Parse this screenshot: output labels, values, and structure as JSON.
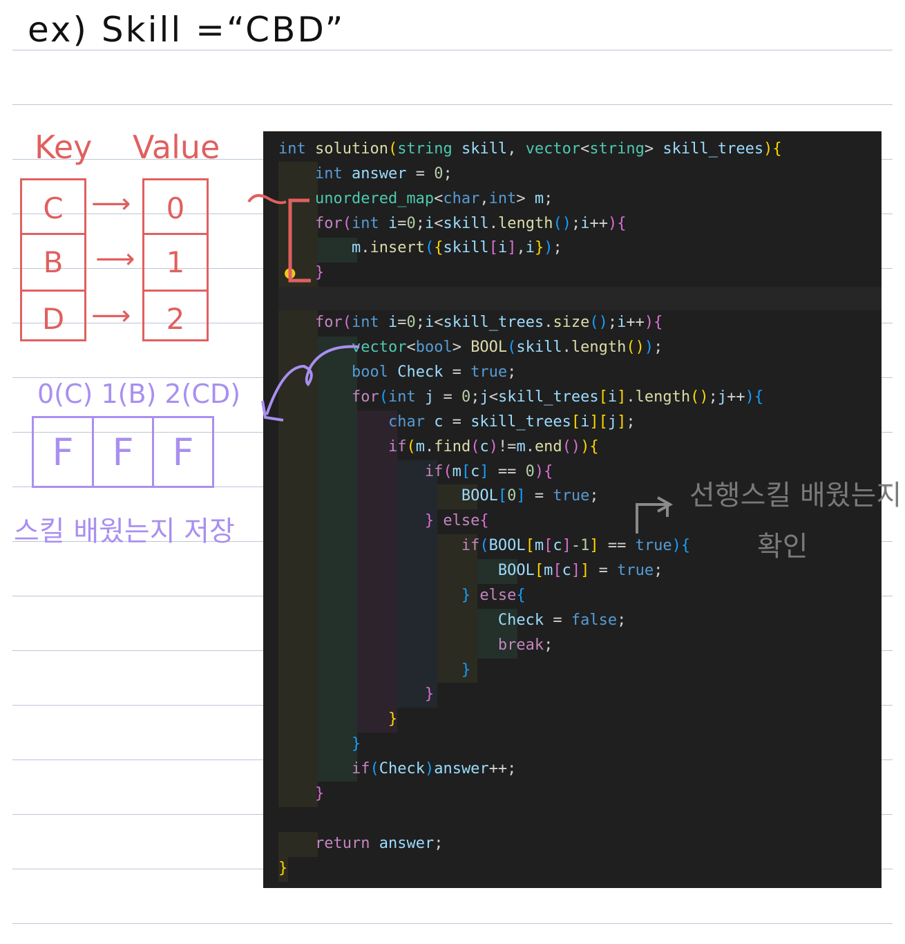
{
  "note": {
    "title": "ex) Skill =“CBD”",
    "map_key_label": "Key",
    "map_value_label": "Value",
    "map_rows": [
      {
        "key": "C",
        "value": "0"
      },
      {
        "key": "B",
        "value": "1"
      },
      {
        "key": "D",
        "value": "2"
      }
    ],
    "vector_header": "0(C) 1(B) 2(CD)",
    "vector_cells": [
      "F",
      "F",
      "F"
    ],
    "vector_caption": "스킬 배웠는지 저장",
    "check_caption_line1": "선행스킬 배웠는지",
    "check_caption_line2": "확인"
  },
  "code": {
    "lines": [
      "int solution(string skill, vector<string> skill_trees){",
      "    int answer = 0;",
      "    unordered_map<char,int> m;",
      "    for(int i=0;i<skill.length();i++){",
      "        m.insert({skill[i],i});",
      "    }",
      "",
      "    for(int i=0;i<skill_trees.size();i++){",
      "        vector<bool> BOOL(skill.length());",
      "        bool Check = true;",
      "        for(int j = 0;j<skill_trees[i].length();j++){",
      "            char c = skill_trees[i][j];",
      "            if(m.find(c)!=m.end()){",
      "                if(m[c] == 0){",
      "                    BOOL[0] = true;",
      "                } else{",
      "                    if(BOOL[m[c]-1] == true){",
      "                        BOOL[m[c]] = true;",
      "                    } else{",
      "                        Check = false;",
      "                        break;",
      "                    }",
      "                }",
      "            }",
      "        }",
      "        if(Check)answer++;",
      "    }",
      "",
      "    return answer;",
      "}"
    ]
  }
}
